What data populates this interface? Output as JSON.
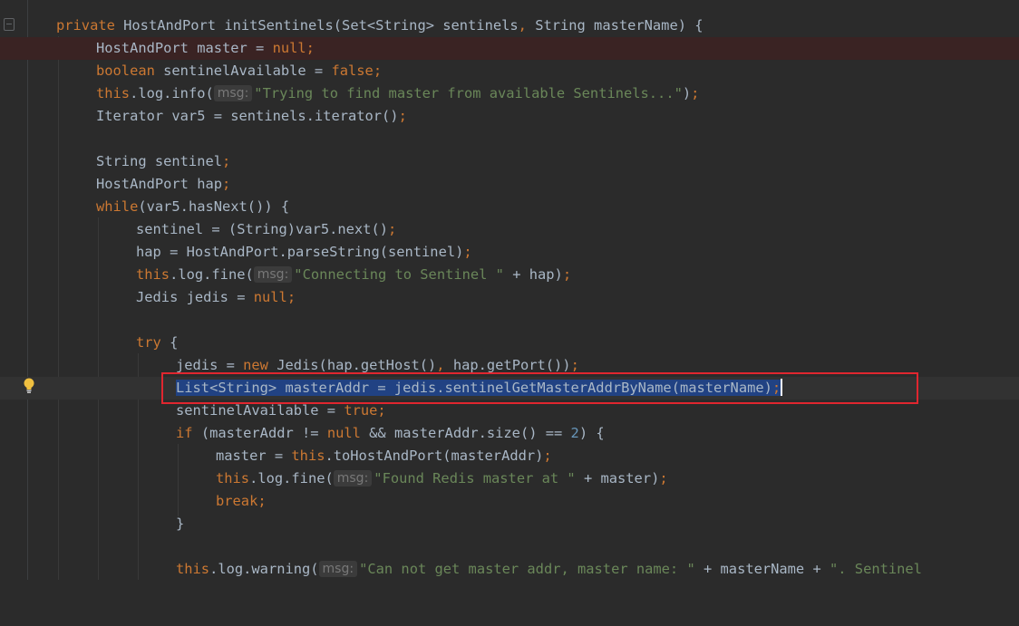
{
  "editor": {
    "colors": {
      "background": "#2b2b2b",
      "keyword": "#cc7832",
      "string": "#6a8759",
      "number": "#6897bb",
      "identifier": "#a9b7c6",
      "selection": "#214283",
      "highlight_box": "#e0262f"
    },
    "gutter_icons": [
      "fold-icon",
      "lightbulb-icon"
    ],
    "hints": {
      "msg": "msg:"
    },
    "lines": {
      "l0": {
        "a": "private",
        "b": " HostAndPort initSentinels(Set<String> sentinels",
        "c": ",",
        "d": " String masterName) {"
      },
      "l1": {
        "a": "HostAndPort master = ",
        "b": "null",
        "c": ";"
      },
      "l2": {
        "a": "boolean",
        "b": " sentinelAvailable = ",
        "c": "false",
        "d": ";"
      },
      "l3": {
        "a": "this",
        "b": ".log.info(",
        "c": "\"Trying to find master from available Sentinels...\"",
        "d": ")",
        "e": ";"
      },
      "l4": {
        "a": "Iterator var5 = sentinels.iterator()",
        "b": ";"
      },
      "l6": {
        "a": "String sentinel",
        "b": ";"
      },
      "l7": {
        "a": "HostAndPort hap",
        "b": ";"
      },
      "l8": {
        "a": "while",
        "b": "(var5.hasNext()) {"
      },
      "l9": {
        "a": "sentinel = (String)var5.next()",
        "b": ";"
      },
      "l10": {
        "a": "hap = HostAndPort.parseString(sentinel)",
        "b": ";"
      },
      "l11": {
        "a": "this",
        "b": ".log.fine(",
        "c": "\"Connecting to Sentinel \"",
        "d": " + hap)",
        "e": ";"
      },
      "l12": {
        "a": "Jedis jedis = ",
        "b": "null",
        "c": ";"
      },
      "l14": {
        "a": "try",
        "b": " {"
      },
      "l15": {
        "a": "jedis = ",
        "b": "new",
        "c": " Jedis(hap.getHost()",
        "d": ",",
        "e": " hap.getPort())",
        "f": ";"
      },
      "l16": {
        "a": "List<String> masterAddr = jedis.sentinelGetMasterAddrByName(masterName)",
        "b": ";"
      },
      "l17": {
        "a": "sentinelAvailable = ",
        "b": "true",
        "c": ";"
      },
      "l18": {
        "a": "if",
        "b": " (masterAddr != ",
        "c": "null",
        "d": " && masterAddr.size() == ",
        "e": "2",
        "f": ") {"
      },
      "l19": {
        "a": "master = ",
        "b": "this",
        "c": ".toHostAndPort(masterAddr)",
        "d": ";"
      },
      "l20": {
        "a": "this",
        "b": ".log.fine(",
        "c": "\"Found Redis master at \"",
        "d": " + master)",
        "e": ";"
      },
      "l21": {
        "a": "break",
        "b": ";"
      },
      "l22": {
        "a": "}"
      },
      "l24": {
        "a": "this",
        "b": ".log.warning(",
        "c": "\"Can not get master addr, master name: \"",
        "d": " + masterName + ",
        "e": "\". Sentinel"
      }
    }
  }
}
